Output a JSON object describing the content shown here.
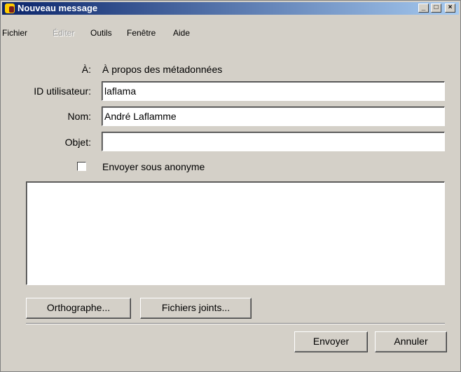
{
  "window": {
    "title": "Nouveau message",
    "controls": {
      "minimize": "_",
      "maximize": "□",
      "close": "×"
    }
  },
  "menu": {
    "items": [
      {
        "label": "Fichier",
        "enabled": true
      },
      {
        "label": "Éditer",
        "enabled": false
      },
      {
        "label": "Outils",
        "enabled": true
      },
      {
        "label": "Fenêtre",
        "enabled": true
      },
      {
        "label": "Aide",
        "enabled": true
      }
    ]
  },
  "form": {
    "to": {
      "label": "À:",
      "value": "À propos des métadonnées"
    },
    "user_id": {
      "label": "ID utilisateur:",
      "value": "laflama"
    },
    "name": {
      "label": "Nom:",
      "value": "André Laflamme"
    },
    "subject": {
      "label": "Objet:",
      "value": ""
    },
    "anonymous": {
      "label": "Envoyer sous anonyme",
      "checked": false
    },
    "body": {
      "value": ""
    }
  },
  "buttons": {
    "spelling": "Orthographe...",
    "attachments": "Fichiers joints...",
    "send": "Envoyer",
    "cancel": "Annuler"
  },
  "colors": {
    "titlebar_start": "#0a246a",
    "titlebar_end": "#a6caf0",
    "face": "#d4d0c8"
  }
}
